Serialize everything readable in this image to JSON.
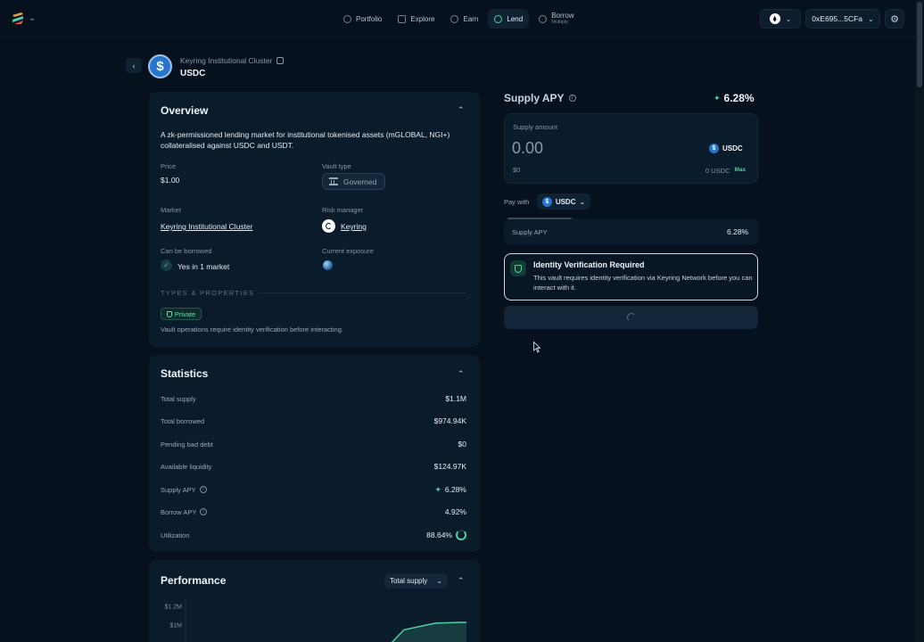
{
  "nav": {
    "items": [
      {
        "label": "Portfolio"
      },
      {
        "label": "Explore"
      },
      {
        "label": "Earn"
      },
      {
        "label": "Lend"
      },
      {
        "label": "Borrow",
        "sub": "Multiply"
      }
    ],
    "active": "Lend"
  },
  "wallet": {
    "address": "0xE695...5CFa"
  },
  "asset": {
    "breadcrumb": "Keyring Institutional Cluster",
    "title": "USDC",
    "icon": "usdc-icon"
  },
  "overview": {
    "title": "Overview",
    "description": "A zk-permissioned lending market for institutional tokenised assets (mGLOBAL, NGI+) collateralised against USDC and USDT.",
    "price_label": "Price",
    "price": "$1.00",
    "vault_type_label": "Vault type",
    "vault_type": "Governed",
    "market_label": "Market",
    "market": "Keyring Institutional Cluster",
    "risk_manager_label": "Risk manager",
    "risk_manager": "Keyring",
    "borrowed_label": "Can be borrowed",
    "borrowed": "Yes in 1 market",
    "exposure_label": "Current exposure",
    "types_label": "TYPES & PROPERTIES",
    "private_badge": "Private",
    "private_note": "Vault operations require identity verification before interacting."
  },
  "statistics": {
    "title": "Statistics",
    "rows": [
      {
        "label": "Total supply",
        "value": "$1.1M"
      },
      {
        "label": "Total borrowed",
        "value": "$974.94K"
      },
      {
        "label": "Pending bad debt",
        "value": "$0"
      },
      {
        "label": "Available liquidity",
        "value": "$124.97K"
      },
      {
        "label": "Supply APY",
        "value": "6.28%"
      },
      {
        "label": "Borrow APY",
        "value": "4.92%"
      },
      {
        "label": "Utilization",
        "value": "88.64%"
      }
    ],
    "utilization": 0.8864
  },
  "performance": {
    "title": "Performance",
    "metric": "Total supply"
  },
  "chart_data": {
    "type": "area",
    "ytick_labels": [
      "$1.2M",
      "$1M"
    ],
    "x": [
      0,
      1,
      2,
      3,
      4,
      5,
      6,
      7,
      8,
      9
    ],
    "values": [
      0,
      0,
      0,
      0,
      0,
      0,
      0.45,
      0.95,
      1.02,
      1.03
    ]
  },
  "supply": {
    "apy_label": "Supply APY",
    "apy": "6.28%",
    "amount_label": "Supply amount",
    "amount": "0.00",
    "amount_usd": "$0",
    "token": "USDC",
    "balance": "0 USDC",
    "max_label": "Max",
    "pay_with_label": "Pay with",
    "pay_with_token": "USDC",
    "summary_label": "Supply APY",
    "summary_value": "6.28%"
  },
  "identity": {
    "title": "Identity Verification Required",
    "text": "This vault requires identity verification via Keyring Network before you can interact with it."
  },
  "colors": {
    "background": "#06111d",
    "card": "#0a1b2b",
    "accent": "#4fd1a5",
    "usdc": "#2775ca"
  }
}
